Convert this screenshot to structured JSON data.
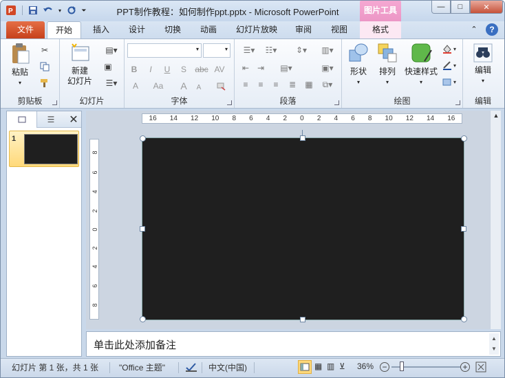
{
  "window": {
    "title": "PPT制作教程：如何制作ppt.pptx  -  Microsoft PowerPoint",
    "context_tab_group": "图片工具",
    "controls": {
      "minimize": "—",
      "maximize": "□",
      "close": "✕"
    }
  },
  "quick_access": {
    "app_icon": "P"
  },
  "tabs": [
    "文件",
    "开始",
    "插入",
    "设计",
    "切换",
    "动画",
    "幻灯片放映",
    "审阅",
    "视图",
    "格式"
  ],
  "ribbon": {
    "groups": {
      "clipboard": {
        "label": "剪贴板",
        "paste": "粘贴"
      },
      "slides": {
        "label": "幻灯片",
        "new_slide_line1": "新建",
        "new_slide_line2": "幻灯片"
      },
      "font": {
        "label": "字体",
        "font_name": "",
        "font_size": "",
        "bold": "B",
        "italic": "I",
        "underline": "U",
        "shadow": "S",
        "strike": "abc",
        "spacing": "AV",
        "color": "A",
        "case": "Aa",
        "grow": "A",
        "shrink": "A"
      },
      "paragraph": {
        "label": "段落"
      },
      "drawing": {
        "label": "绘图",
        "shapes": "形状",
        "arrange": "排列",
        "quick_styles": "快速样式"
      },
      "editing": {
        "label": "编辑",
        "edit": "编辑"
      }
    }
  },
  "ruler": {
    "horizontal": [
      "16",
      "14",
      "12",
      "10",
      "8",
      "6",
      "4",
      "2",
      "0",
      "2",
      "4",
      "6",
      "8",
      "10",
      "12",
      "14",
      "16"
    ],
    "vertical": [
      "8",
      "6",
      "4",
      "2",
      "0",
      "2",
      "4",
      "6",
      "8"
    ]
  },
  "slides_panel": {
    "thumb_number": "1"
  },
  "notes": {
    "placeholder": "单击此处添加备注"
  },
  "status": {
    "slide_info": "幻灯片 第 1 张，共 1 张",
    "theme": "\"Office 主题\"",
    "language": "中文(中国)",
    "zoom": "36%"
  },
  "colors": {
    "slide_bg": "#1f1f1f",
    "file_tab": "#d2532a",
    "context_tab": "#e98cc0"
  }
}
